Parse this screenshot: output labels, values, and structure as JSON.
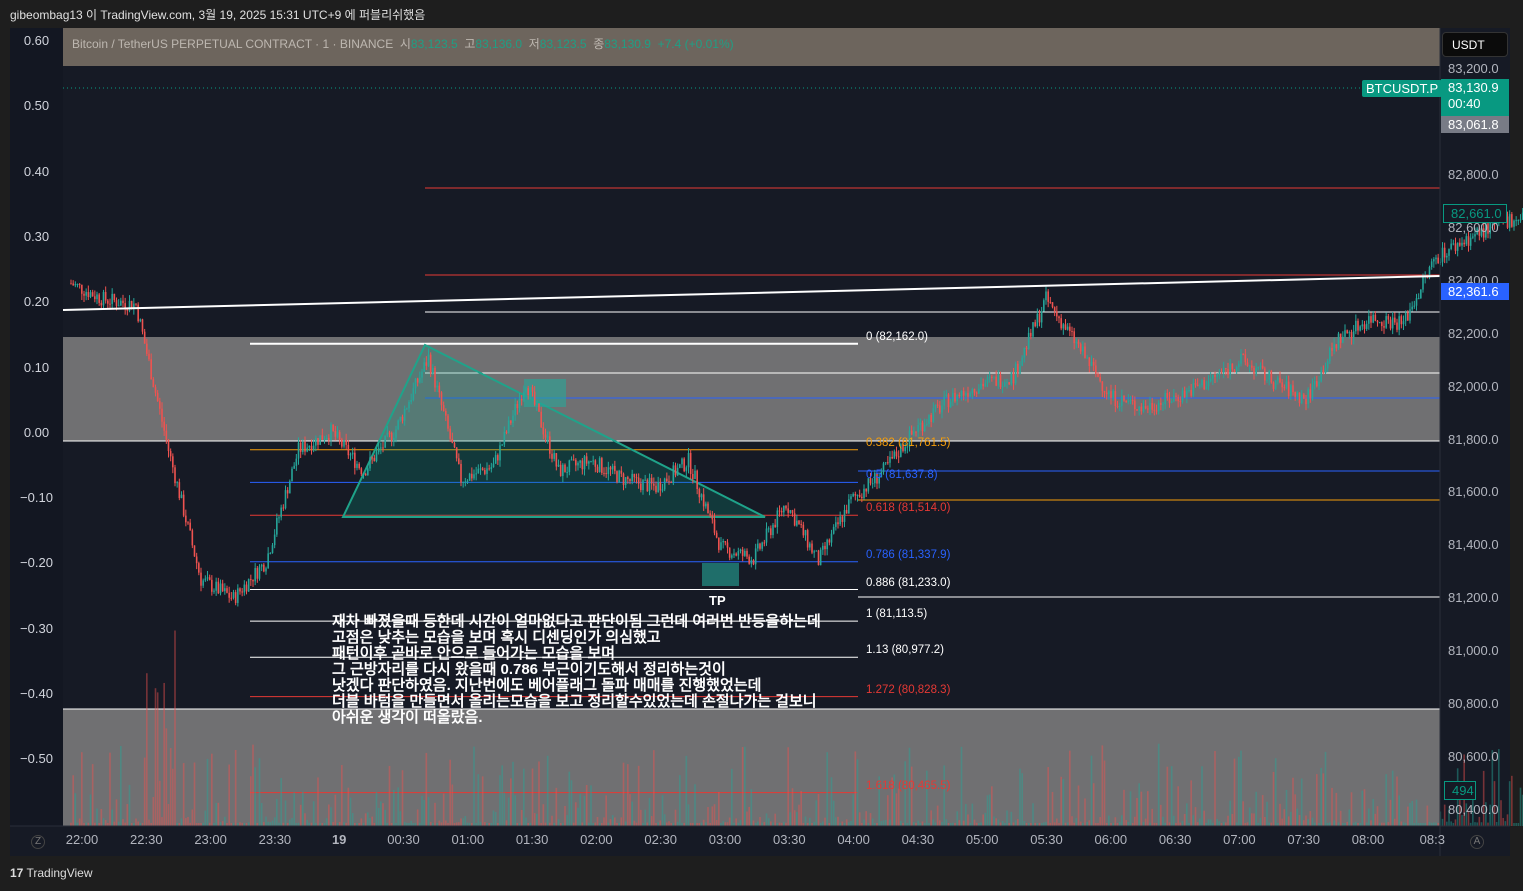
{
  "header": {
    "published": "gibeombag13 이 TradingView.com, 3월 19, 2025 15:31 UTC+9 에 퍼블리쉬했음"
  },
  "legend": {
    "symbol": "Bitcoin / TetherUS PERPETUAL CONTRACT · 1 · BINANCE",
    "open_label": "시",
    "open": "83,123.5",
    "high_label": "고",
    "high": "83,136.0",
    "low_label": "저",
    "low": "83,123.5",
    "close_label": "종",
    "close": "83,130.9",
    "change": "+7.4 (+0.01%)"
  },
  "left_axis": [
    "0.60",
    "0.50",
    "0.40",
    "0.30",
    "0.20",
    "0.10",
    "0.00",
    "−0.10",
    "−0.20",
    "−0.30",
    "−0.40",
    "−0.50"
  ],
  "price_axis": {
    "currency": "USDT",
    "ticks": [
      "83,200.0",
      "82,800.0",
      "82,600.0",
      "82,400.0",
      "82,200.0",
      "82,000.0",
      "81,800.0",
      "81,600.0",
      "81,400.0",
      "81,200.0",
      "81,000.0",
      "80,800.0",
      "80,600.0",
      "80,400.0"
    ]
  },
  "badges": {
    "symbol": "BTCUSDT.P",
    "last": "83,130.9",
    "countdown": "00:40",
    "prev": "83,061.8",
    "level1": "82,661.0",
    "trendline": "82,361.6",
    "volume": "494"
  },
  "colors": {
    "up": "#26a69a",
    "down": "#ef5350",
    "teal": "#089981",
    "blue": "#2962ff"
  },
  "fib_levels": [
    {
      "label": "0 (82,162.0)",
      "price": 82162.0,
      "color": "#ffffff"
    },
    {
      "label": "0.382 (81,761.5)",
      "price": 81761.5,
      "color": "#f59e0b"
    },
    {
      "label": "0.5 (81,637.8)",
      "price": 81637.8,
      "color": "#2962ff"
    },
    {
      "label": "0.618 (81,514.0)",
      "price": 81514.0,
      "color": "#e53935"
    },
    {
      "label": "0.786 (81,337.9)",
      "price": 81337.9,
      "color": "#2962ff"
    },
    {
      "label": "0.886 (81,233.0)",
      "price": 81233.0,
      "color": "#ffffff"
    },
    {
      "label": "1 (81,113.5)",
      "price": 81113.5,
      "color": "#ffffff"
    },
    {
      "label": "1.13 (80,977.2)",
      "price": 80977.2,
      "color": "#ffffff"
    },
    {
      "label": "1.272 (80,828.3)",
      "price": 80828.3,
      "color": "#e53935"
    },
    {
      "label": "1.618 (80,465.5)",
      "price": 80465.5,
      "color": "#e53935"
    }
  ],
  "tp_label": "TP",
  "note": "재차 빠졌을때 등한데 시간이 얼마없다고 판단이됨 그런데 여러번 반등을하는데\n고점은 낮추는 모습을 보며 혹시 디센딩인가 의심했고\n패턴이후 곧바로 안으로 들어가는 모습을 보며\n그 근방자리를 다시 왔을때 0.786 부근이기도해서 정리하는것이\n낫겠다 판단하였음. 지난번에도 베어플래그 돌파 매매를 진행했었는데\n더블 바텀을 만들면서 올리는모습을 보고 정리할수있었는데 손절나가는 걸보니\n아쉬운 생각이 떠올랐음.",
  "footer": "TradingView",
  "scale_buttons": {
    "left": "Z",
    "right": "A"
  },
  "chart_data": {
    "type": "candlestick",
    "title": "Bitcoin / TetherUS PERPETUAL CONTRACT · 1 · BINANCE",
    "x_ticks": [
      "22:00",
      "22:30",
      "23:00",
      "23:30",
      "19",
      "00:30",
      "01:00",
      "01:30",
      "02:00",
      "02:30",
      "03:00",
      "03:30",
      "04:00",
      "04:30",
      "05:00",
      "05:30",
      "06:00",
      "06:30",
      "07:00",
      "07:30",
      "08:00",
      "08:3"
    ],
    "ylim": [
      80350,
      83300
    ],
    "interval_minutes": 15,
    "start": "21:55",
    "closes": [
      82390,
      82330,
      82310,
      81760,
      81270,
      81200,
      81340,
      81760,
      81830,
      81680,
      81840,
      82110,
      81650,
      81700,
      82020,
      81680,
      81720,
      81650,
      81620,
      81720,
      81390,
      81350,
      81560,
      81340,
      81570,
      81680,
      81840,
      81950,
      82010,
      82040,
      82330,
      82150,
      81960,
      81920,
      81960,
      82020,
      82100,
      82020,
      81950,
      82180,
      82260,
      82240,
      82490,
      82560,
      82620,
      82660
    ]
  }
}
